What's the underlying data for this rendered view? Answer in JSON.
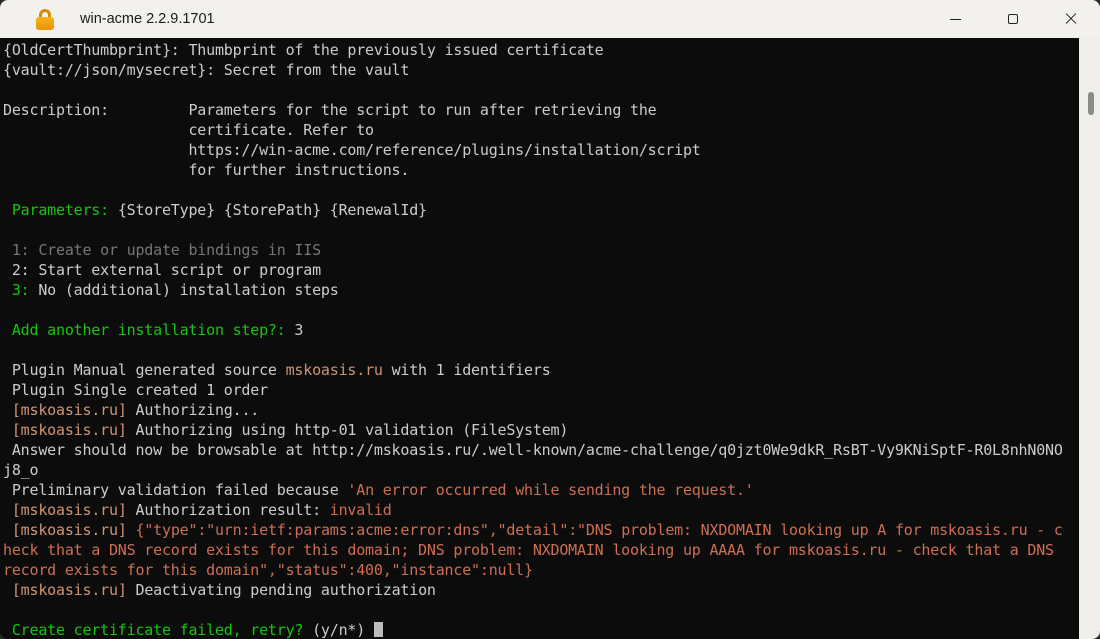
{
  "window": {
    "title": "win-acme 2.2.9.1701",
    "icons": {
      "titlebar_app": "lock-icon",
      "minimize": "minimize-icon",
      "maximize": "maximize-icon",
      "close": "close-icon"
    }
  },
  "terminal": {
    "background": "#0c0c0c",
    "colors": {
      "default": "#cccccc",
      "dim": "#767676",
      "green": "#16c60c",
      "identifier": "#ce9472",
      "error": "#cd6e52",
      "cursor": "#bcbcbc"
    },
    "scrollbar": {
      "track": "#f0eeea",
      "thumb": "#8a8a88"
    },
    "lines": [
      [
        {
          "t": "{OldCertThumbprint}: Thumbprint of the previously issued certificate",
          "c": "default"
        }
      ],
      [
        {
          "t": "{vault://json/mysecret}: Secret from the vault",
          "c": "default"
        }
      ],
      [],
      [
        {
          "t": "Description:         Parameters for the script to run after retrieving the",
          "c": "default"
        }
      ],
      [
        {
          "t": "                     certificate. Refer to",
          "c": "default"
        }
      ],
      [
        {
          "t": "                     https://win-acme.com/reference/plugins/installation/script",
          "c": "default"
        }
      ],
      [
        {
          "t": "                     for further instructions.",
          "c": "default"
        }
      ],
      [],
      [
        {
          "t": " Parameters: ",
          "c": "green"
        },
        {
          "t": "{StoreType} {StorePath} {RenewalId}",
          "c": "default"
        }
      ],
      [],
      [
        {
          "t": " 1: Create or update bindings in IIS",
          "c": "dim"
        }
      ],
      [
        {
          "t": " 2: Start external script or program",
          "c": "default"
        }
      ],
      [
        {
          "t": " 3:",
          "c": "green"
        },
        {
          "t": " No (additional) installation steps",
          "c": "default"
        }
      ],
      [],
      [
        {
          "t": " Add another installation step?: ",
          "c": "green"
        },
        {
          "t": "3",
          "c": "default"
        }
      ],
      [],
      [
        {
          "t": " Plugin Manual generated source ",
          "c": "default"
        },
        {
          "t": "mskoasis.ru",
          "c": "identifier"
        },
        {
          "t": " with 1 identifiers",
          "c": "default"
        }
      ],
      [
        {
          "t": " Plugin Single created 1 order",
          "c": "default"
        }
      ],
      [
        {
          "t": " ",
          "c": "default"
        },
        {
          "t": "[mskoasis.ru]",
          "c": "identifier"
        },
        {
          "t": " Authorizing...",
          "c": "default"
        }
      ],
      [
        {
          "t": " ",
          "c": "default"
        },
        {
          "t": "[mskoasis.ru]",
          "c": "identifier"
        },
        {
          "t": " Authorizing using http-01 validation (FileSystem)",
          "c": "default"
        }
      ],
      [
        {
          "t": " Answer should now be browsable at http://mskoasis.ru/.well-known/acme-challenge/q0jzt0We9dkR_RsBT-Vy9KNiSptF-R0L8nhN0NO",
          "c": "default"
        }
      ],
      [
        {
          "t": "j8_o",
          "c": "default"
        }
      ],
      [
        {
          "t": " Preliminary validation failed because ",
          "c": "default"
        },
        {
          "t": "'An error occurred while sending the request.'",
          "c": "error"
        }
      ],
      [
        {
          "t": " ",
          "c": "default"
        },
        {
          "t": "[mskoasis.ru]",
          "c": "identifier"
        },
        {
          "t": " Authorization result: ",
          "c": "default"
        },
        {
          "t": "invalid",
          "c": "error"
        }
      ],
      [
        {
          "t": " ",
          "c": "default"
        },
        {
          "t": "[mskoasis.ru]",
          "c": "identifier"
        },
        {
          "t": " ",
          "c": "default"
        },
        {
          "t": "{\"type\":\"urn:ietf:params:acme:error:dns\",\"detail\":\"DNS problem: NXDOMAIN looking up A for mskoasis.ru - c",
          "c": "error"
        }
      ],
      [
        {
          "t": "heck that a DNS record exists for this domain; DNS problem: NXDOMAIN looking up AAAA for mskoasis.ru - check that a DNS ",
          "c": "error"
        }
      ],
      [
        {
          "t": "record exists for this domain\",\"status\":400,\"instance\":null}",
          "c": "error"
        }
      ],
      [
        {
          "t": " ",
          "c": "default"
        },
        {
          "t": "[mskoasis.ru]",
          "c": "identifier"
        },
        {
          "t": " Deactivating pending authorization",
          "c": "default"
        }
      ],
      [],
      [
        {
          "t": " Create certificate failed, retry? ",
          "c": "green"
        },
        {
          "t": "(y/n*) ",
          "c": "default"
        },
        {
          "cursor": true
        }
      ]
    ]
  }
}
